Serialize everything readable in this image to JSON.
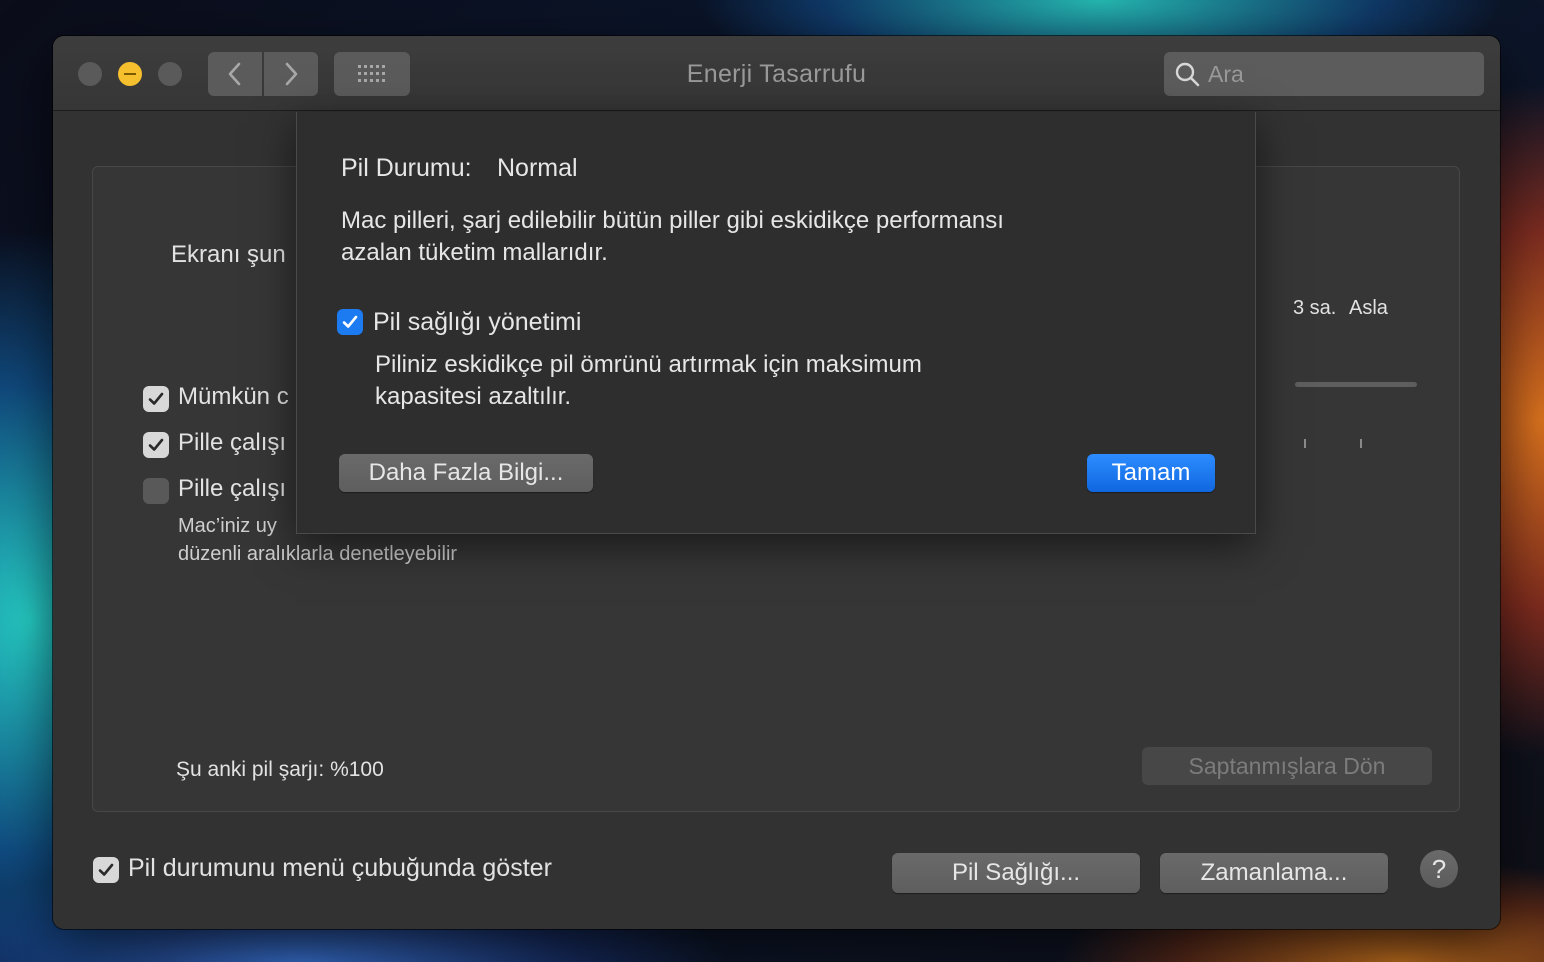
{
  "window": {
    "title": "Enerji Tasarrufu",
    "search_placeholder": "Ara"
  },
  "panel": {
    "display_sleep_label": "Ekranı şun",
    "slider_labels": [
      "3 sa.",
      "Asla"
    ],
    "options": [
      {
        "label": "Mümkün c",
        "checked": true
      },
      {
        "label": "Pille çalışı",
        "checked": true
      },
      {
        "label": "Pille çalışı",
        "checked": false
      }
    ],
    "option_note_line1": "Mac’iniz uy",
    "option_note_line2": "düzenli aralıklarla denetleyebilir",
    "battery_charge": "Şu anki pil şarjı: %100",
    "restore_defaults": "Saptanmışlara Dön"
  },
  "footer": {
    "show_in_menubar_label": "Pil durumunu menü çubuğunda göster",
    "show_in_menubar_checked": true,
    "battery_health_button": "Pil Sağlığı...",
    "schedule_button": "Zamanlama...",
    "help": "?"
  },
  "sheet": {
    "status_label": "Pil Durumu:",
    "status_value": "Normal",
    "description_line1": "Mac pilleri, şarj edilebilir bütün piller gibi eskidikçe performansı",
    "description_line2": "azalan tüketim mallarıdır.",
    "management_label": "Pil sağlığı yönetimi",
    "management_checked": true,
    "management_desc_line1": "Piliniz eskidikçe pil ömrünü artırmak için maksimum",
    "management_desc_line2": "kapasitesi azaltılır.",
    "more_info_button": "Daha Fazla Bilgi...",
    "ok_button": "Tamam"
  },
  "colors": {
    "accent": "#1d7bf2",
    "minimize": "#f5bf2e",
    "window_bg": "#323232"
  }
}
